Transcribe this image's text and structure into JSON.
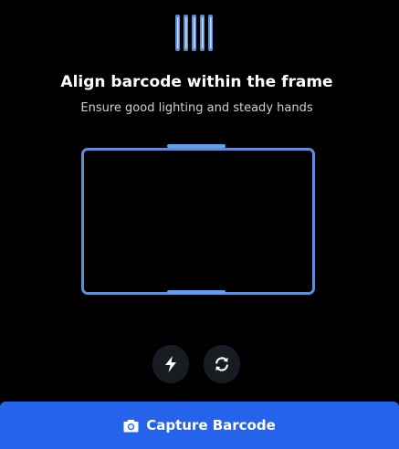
{
  "header": {
    "icon": "barcode-icon",
    "title": "Align barcode within the frame",
    "subtitle": "Ensure good lighting and steady hands"
  },
  "controls": {
    "flash_icon": "flash-icon",
    "switch_icon": "camera-switch-icon"
  },
  "capture": {
    "icon": "camera-icon",
    "label": "Capture Barcode"
  },
  "colors": {
    "accent": "#2563eb",
    "frame": "#5b8fd8",
    "background": "#000000",
    "control_bg": "#171b22"
  }
}
